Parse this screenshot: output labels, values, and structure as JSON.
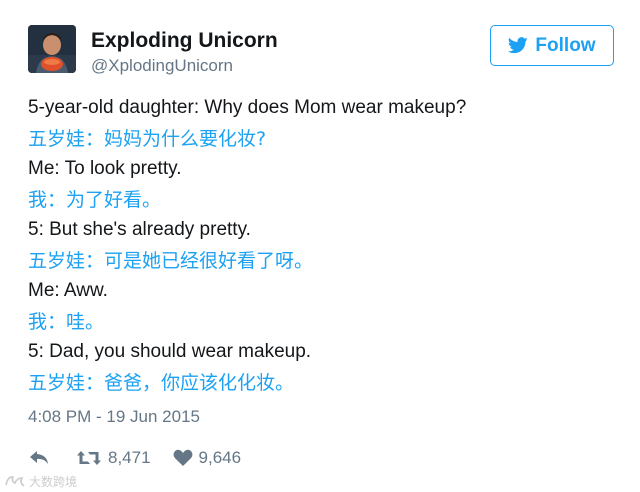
{
  "user": {
    "display_name": "Exploding Unicorn",
    "handle": "@XplodingUnicorn"
  },
  "follow_button": {
    "label": "Follow"
  },
  "tweet": {
    "lines": [
      {
        "text": "5-year-old daughter: Why does Mom wear makeup?",
        "lang": "en"
      },
      {
        "text": "五岁娃：妈妈为什么要化妆?",
        "lang": "zh"
      },
      {
        "text": "Me: To look pretty.",
        "lang": "en"
      },
      {
        "text": "我：为了好看。",
        "lang": "zh"
      },
      {
        "text": "5: But she's already pretty.",
        "lang": "en"
      },
      {
        "text": "五岁娃：可是她已经很好看了呀。",
        "lang": "zh"
      },
      {
        "text": "Me: Aww.",
        "lang": "en"
      },
      {
        "text": "我：哇。",
        "lang": "zh"
      },
      {
        "text": "5: Dad, you should wear makeup.",
        "lang": "en"
      },
      {
        "text": "五岁娃：爸爸，你应该化化妆。",
        "lang": "zh"
      }
    ],
    "timestamp": "4:08 PM - 19 Jun 2015"
  },
  "actions": {
    "reply_icon": "reply-icon",
    "retweet_icon": "retweet-icon",
    "retweet_count": "8,471",
    "like_icon": "heart-icon",
    "like_count": "9,646"
  },
  "watermark": {
    "text": "大数跨境"
  },
  "colors": {
    "brand_blue": "#1da1f2",
    "text": "#14171a",
    "muted": "#657786"
  }
}
